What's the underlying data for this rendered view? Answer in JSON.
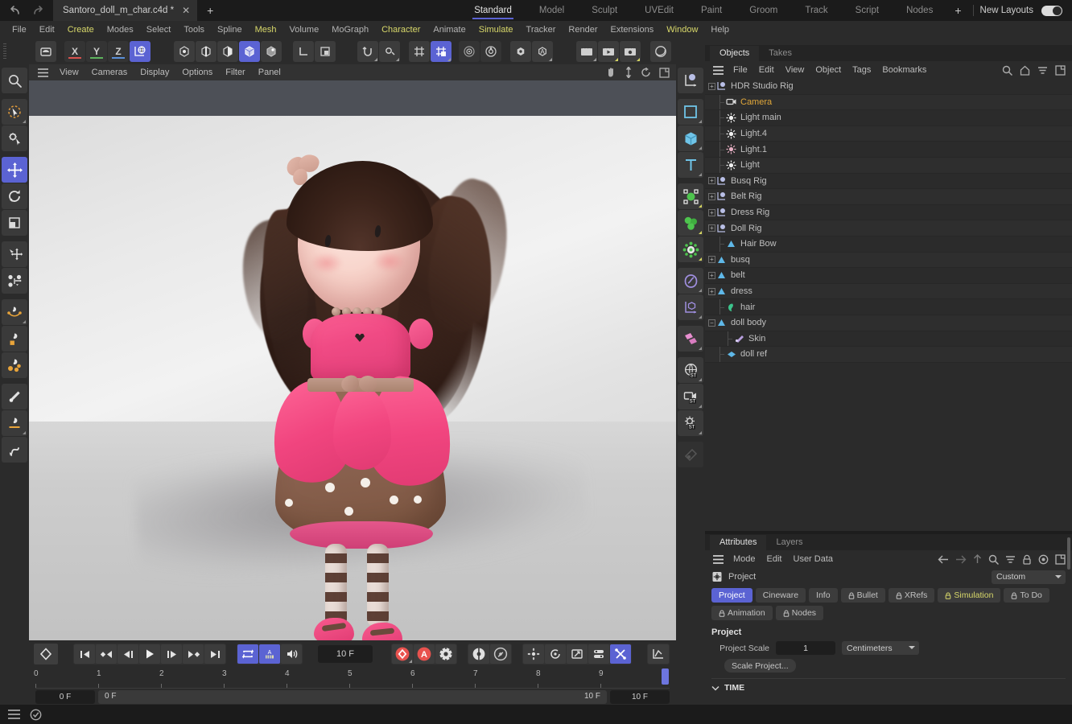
{
  "titlebar": {
    "document_name": "Santoro_doll_m_char.c4d *",
    "close_tab": "✕",
    "new_tab": "+",
    "layouts": [
      {
        "label": "Standard",
        "active": true
      },
      {
        "label": "Model",
        "active": false
      },
      {
        "label": "Sculpt",
        "active": false
      },
      {
        "label": "UVEdit",
        "active": false
      },
      {
        "label": "Paint",
        "active": false
      },
      {
        "label": "Groom",
        "active": false
      },
      {
        "label": "Track",
        "active": false
      },
      {
        "label": "Script",
        "active": false
      },
      {
        "label": "Nodes",
        "active": false
      }
    ],
    "layout_add": "+",
    "new_layouts_label": "New Layouts"
  },
  "menubar": [
    {
      "label": "File",
      "highlight": false
    },
    {
      "label": "Edit",
      "highlight": false
    },
    {
      "label": "Create",
      "highlight": true
    },
    {
      "label": "Modes",
      "highlight": false
    },
    {
      "label": "Select",
      "highlight": false
    },
    {
      "label": "Tools",
      "highlight": false
    },
    {
      "label": "Spline",
      "highlight": false
    },
    {
      "label": "Mesh",
      "highlight": true
    },
    {
      "label": "Volume",
      "highlight": false
    },
    {
      "label": "MoGraph",
      "highlight": false
    },
    {
      "label": "Character",
      "highlight": true
    },
    {
      "label": "Animate",
      "highlight": false
    },
    {
      "label": "Simulate",
      "highlight": true
    },
    {
      "label": "Tracker",
      "highlight": false
    },
    {
      "label": "Render",
      "highlight": false
    },
    {
      "label": "Extensions",
      "highlight": false
    },
    {
      "label": "Window",
      "highlight": true
    },
    {
      "label": "Help",
      "highlight": false
    }
  ],
  "toolbar": {
    "axis_x": "X",
    "axis_y": "Y",
    "axis_z": "Z"
  },
  "viewport": {
    "menu": [
      "View",
      "Cameras",
      "Display",
      "Options",
      "Filter",
      "Panel"
    ]
  },
  "timeline": {
    "current_frame_field": "10 F",
    "ruler_ticks": [
      "0",
      "1",
      "2",
      "3",
      "4",
      "5",
      "6",
      "7",
      "8",
      "9"
    ],
    "range_start": "0 F",
    "range_preview_start": "0 F",
    "range_preview_end": "10 F",
    "range_end": "10 F"
  },
  "objects_panel": {
    "tabs": [
      {
        "label": "Objects",
        "active": true
      },
      {
        "label": "Takes",
        "active": false
      }
    ],
    "menu": [
      "File",
      "Edit",
      "View",
      "Object",
      "Tags",
      "Bookmarks"
    ],
    "rows": [
      {
        "name": "HDR Studio Rig",
        "icon": "null-object-icon",
        "depth": 0,
        "expandable": true,
        "selected": false,
        "visibility": "none",
        "layer_color": null,
        "tags": [
          "xpresso"
        ]
      },
      {
        "name": "Camera",
        "icon": "camera-icon",
        "depth": 1,
        "expandable": false,
        "selected": true,
        "visibility": "target",
        "layer_color": null,
        "tags": []
      },
      {
        "name": "Light main",
        "icon": "light-icon",
        "depth": 1,
        "expandable": false,
        "selected": false,
        "visibility": "check",
        "layer_color": null,
        "tags": []
      },
      {
        "name": "Light.4",
        "icon": "light-icon",
        "depth": 1,
        "expandable": false,
        "selected": false,
        "visibility": "check",
        "layer_color": null,
        "tags": []
      },
      {
        "name": "Light.1",
        "icon": "light-pink-icon",
        "depth": 1,
        "expandable": false,
        "selected": false,
        "visibility": "check",
        "layer_color": null,
        "tags": []
      },
      {
        "name": "Light",
        "icon": "light-icon",
        "depth": 1,
        "expandable": false,
        "selected": false,
        "visibility": "check",
        "layer_color": null,
        "tags": []
      },
      {
        "name": "Busq Rig",
        "icon": "null-object-icon",
        "depth": 0,
        "expandable": true,
        "selected": false,
        "visibility": "none",
        "layer_color": null,
        "tags": []
      },
      {
        "name": "Belt Rig",
        "icon": "null-object-icon",
        "depth": 0,
        "expandable": true,
        "selected": false,
        "visibility": "none",
        "layer_color": null,
        "tags": []
      },
      {
        "name": "Dress Rig",
        "icon": "null-object-icon",
        "depth": 0,
        "expandable": true,
        "selected": false,
        "visibility": "none",
        "layer_color": null,
        "tags": [
          "xpresso"
        ]
      },
      {
        "name": "Doll Rig",
        "icon": "null-object-icon",
        "depth": 0,
        "expandable": true,
        "selected": false,
        "visibility": "none",
        "layer_color": null,
        "tags": []
      },
      {
        "name": "Hair Bow",
        "icon": "polygon-icon",
        "depth": 1,
        "expandable": false,
        "selected": false,
        "visibility": "none",
        "layer_color": null,
        "tags": [
          "mat-wood",
          "mat-wood",
          "mat-wood",
          "mat-wood",
          "mat-wood",
          "tri",
          "tri",
          "tri",
          "tri",
          "tri",
          "uv",
          "checker"
        ]
      },
      {
        "name": "busq",
        "icon": "polygon-icon",
        "depth": 0,
        "expandable": true,
        "selected": false,
        "visibility": "none",
        "layer_color": null,
        "tags": [
          "lock",
          "mat-dark",
          "uv",
          "checker"
        ]
      },
      {
        "name": "belt",
        "icon": "polygon-icon",
        "depth": 0,
        "expandable": true,
        "selected": false,
        "visibility": "none",
        "layer_color": null,
        "tags": [
          "lock",
          "mat-wood",
          "mat-wood",
          "mat-wood",
          "mat-wood",
          "mat-wood",
          "tri",
          "tri",
          "tri",
          "tri",
          "tri",
          "uv",
          "checker"
        ]
      },
      {
        "name": "dress",
        "icon": "polygon-icon",
        "depth": 0,
        "expandable": true,
        "selected": false,
        "visibility": "none",
        "layer_color": null,
        "tags": [
          "lock",
          "mat-red",
          "tri",
          "uv",
          "checker",
          "mat-wood",
          "mat-pink",
          "mat-pink",
          "checker",
          "checker",
          "tri",
          "tri",
          "tri",
          "tri"
        ]
      },
      {
        "name": "hair",
        "icon": "hair-icon",
        "depth": 1,
        "expandable": false,
        "selected": false,
        "visibility": "check",
        "layer_color": "#f41f0a",
        "tags": [
          "hatch",
          "uv",
          "curve",
          "curve"
        ]
      },
      {
        "name": "doll body",
        "icon": "polygon-icon",
        "depth": 0,
        "expandable": true,
        "selected": false,
        "visibility": "none",
        "layer_color": null,
        "tags": [
          "lock",
          "mat-skin",
          "mat-skin",
          "mat-black",
          "hatch",
          "mat-rose",
          "tri",
          "tri",
          "tri",
          "tri",
          "tri",
          "uv",
          "checker",
          "tri",
          "tri"
        ]
      },
      {
        "name": "Skin",
        "icon": "skin-tag-icon",
        "depth": 2,
        "expandable": false,
        "selected": false,
        "visibility": "check",
        "layer_color": null,
        "tags": []
      },
      {
        "name": "doll ref",
        "icon": "ref-icon",
        "depth": 1,
        "expandable": false,
        "selected": false,
        "visibility": "cross",
        "layer_color": null,
        "tags": [
          "uv",
          "mat-red"
        ]
      }
    ]
  },
  "attributes_panel": {
    "tabs": [
      {
        "label": "Attributes",
        "active": true
      },
      {
        "label": "Layers",
        "active": false
      }
    ],
    "menu": [
      "Mode",
      "Edit",
      "User Data"
    ],
    "object_title": "Project",
    "preset_value": "Custom",
    "mode_tabs": [
      {
        "label": "Project",
        "active": true,
        "lock": false,
        "yellow": false
      },
      {
        "label": "Cineware",
        "active": false,
        "lock": false,
        "yellow": false
      },
      {
        "label": "Info",
        "active": false,
        "lock": false,
        "yellow": false
      },
      {
        "label": "Bullet",
        "active": false,
        "lock": true,
        "yellow": false
      },
      {
        "label": "XRefs",
        "active": false,
        "lock": true,
        "yellow": false
      },
      {
        "label": "Simulation",
        "active": false,
        "lock": true,
        "yellow": true
      },
      {
        "label": "To Do",
        "active": false,
        "lock": true,
        "yellow": false
      },
      {
        "label": "Animation",
        "active": false,
        "lock": true,
        "yellow": false
      },
      {
        "label": "Nodes",
        "active": false,
        "lock": true,
        "yellow": false
      }
    ],
    "section_title": "Project",
    "project_scale_label": "Project Scale",
    "project_scale_value": "1",
    "project_units": "Centimeters",
    "scale_project_button": "Scale Project...",
    "time_section": "TIME"
  },
  "colors": {
    "accent_blue": "#5b63d3",
    "selected_object": "#e0a73a",
    "highlight_menu": "#d8d86a",
    "layer_red": "#f41f0a",
    "check_green": "#44cc44",
    "cross_red": "#e0483c",
    "record_red": "#e8524e"
  }
}
